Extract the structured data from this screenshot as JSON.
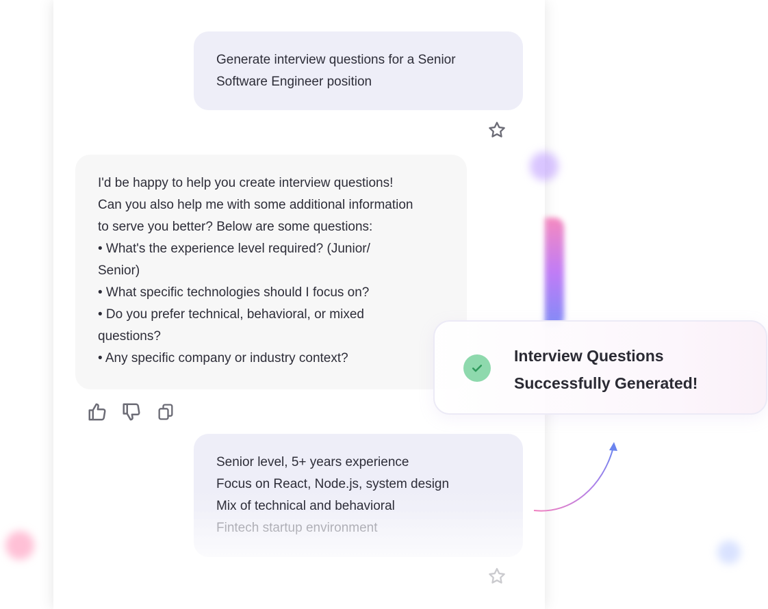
{
  "messages": {
    "user_1": {
      "lines": [
        "Generate interview questions for a Senior",
        "Software Engineer position"
      ]
    },
    "assistant_1": {
      "intro_lines": [
        "I'd be happy to help you create interview questions!",
        "Can you also help me with some additional information",
        "to serve you better? Below are some questions:"
      ],
      "bullets": [
        "• What's the experience level required? (Junior/ Senior)",
        "• What specific technologies should I focus on?",
        "• Do you prefer technical, behavioral, or mixed questions?",
        "• Any specific company or industry context?"
      ]
    },
    "user_2": {
      "lines": [
        "Senior level, 5+ years experience",
        "Focus on React, Node.js, system design",
        "Mix of technical and behavioral",
        "Fintech startup environment"
      ]
    }
  },
  "actions": {
    "icons": [
      "star-icon",
      "thumbs-up-icon",
      "thumbs-down-icon",
      "copy-icon"
    ]
  },
  "toast": {
    "line1": "Interview Questions",
    "line2": "Successfully Generated!",
    "icon": "check-icon",
    "accent": "#8ed9ad"
  }
}
